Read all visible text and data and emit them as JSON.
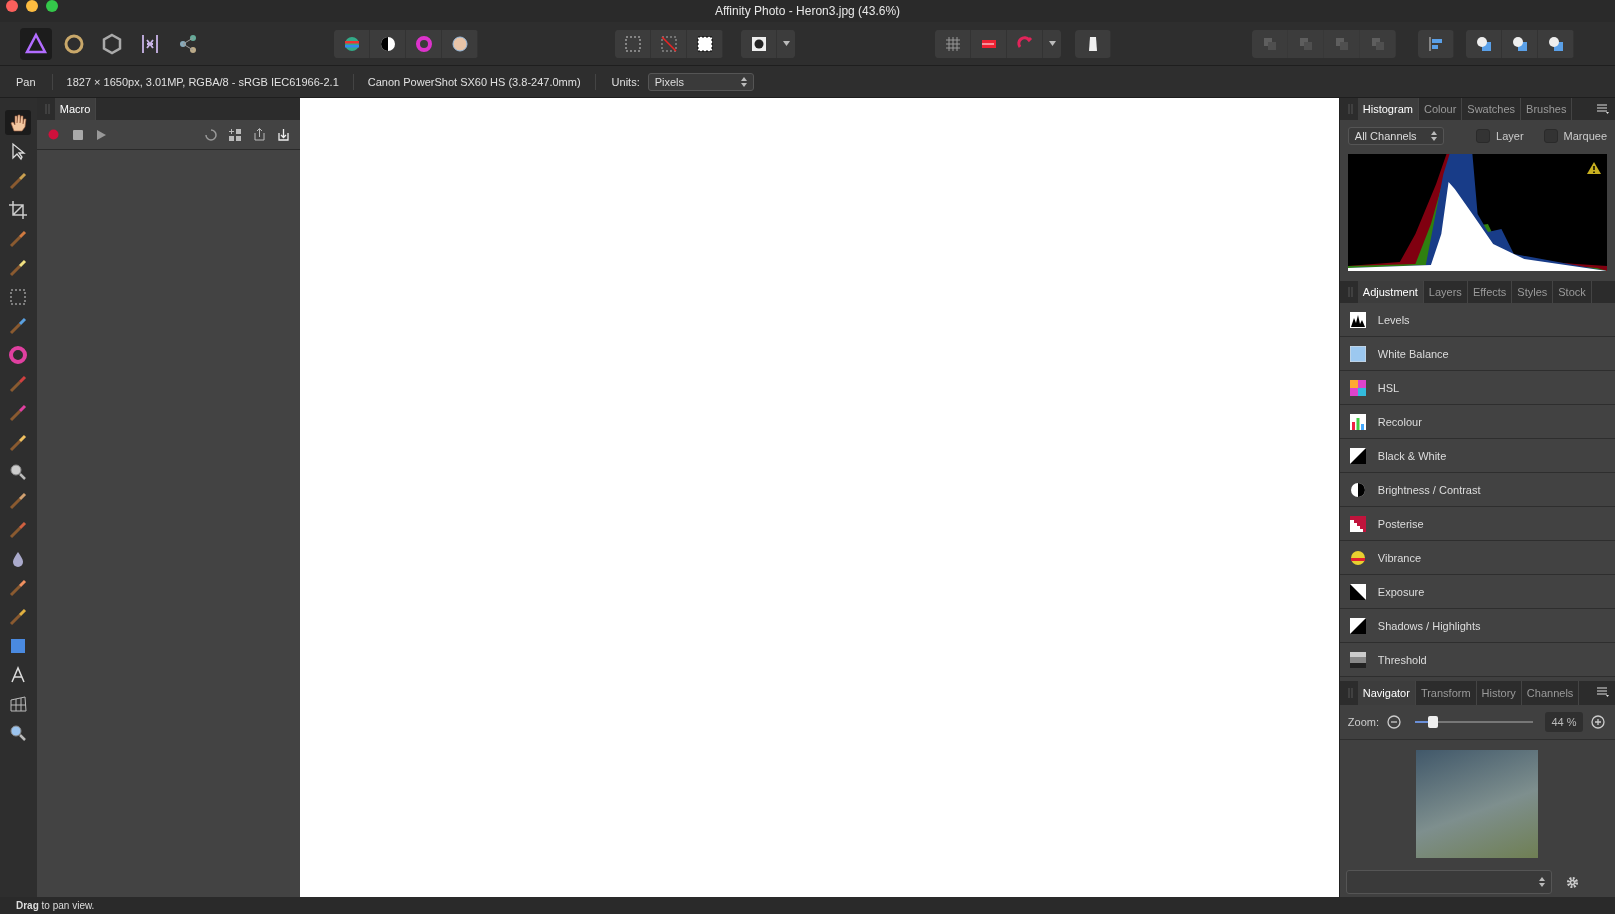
{
  "window": {
    "title": "Affinity Photo - Heron3.jpg (43.6%)"
  },
  "personas": [
    {
      "selected": true
    },
    {
      "selected": false
    },
    {
      "selected": false
    },
    {
      "selected": false
    },
    {
      "selected": false
    }
  ],
  "toolbar_groups": [
    {
      "buttons": [
        {
          "disabled": false
        },
        {
          "disabled": false
        },
        {
          "disabled": false
        },
        {
          "disabled": false
        }
      ]
    },
    {
      "buttons": [
        {
          "disabled": false
        },
        {
          "disabled": false
        },
        {
          "disabled": false
        }
      ]
    },
    {
      "buttons": [
        {
          "disabled": false
        }
      ],
      "dropdown": true
    },
    {
      "buttons": [
        {
          "disabled": false
        },
        {
          "disabled": false
        },
        {
          "disabled": false
        }
      ],
      "dropdown": true
    },
    {
      "buttons": [
        {
          "disabled": false
        }
      ]
    },
    {
      "buttons": [
        {
          "disabled": true
        },
        {
          "disabled": true
        },
        {
          "disabled": true
        },
        {
          "disabled": true
        }
      ]
    },
    {
      "buttons": [
        {
          "disabled": false
        }
      ]
    },
    {
      "buttons": [
        {
          "disabled": false
        },
        {
          "disabled": false
        },
        {
          "disabled": false
        }
      ]
    }
  ],
  "context_bar": {
    "tool": "Pan",
    "image_info": "1827 × 1650px, 3.01MP, RGBA/8 - sRGB IEC61966-2.1",
    "camera": "Canon PowerShot SX60 HS (3.8-247.0mm)",
    "units_label": "Units:",
    "units_value": "Pixels"
  },
  "tools": [
    {
      "selected": true
    },
    {
      "selected": false
    },
    {
      "selected": false
    },
    {
      "selected": false
    },
    {
      "selected": false
    },
    {
      "selected": false
    },
    {
      "selected": false
    },
    {
      "selected": false
    },
    {
      "selected": false
    },
    {
      "selected": false
    },
    {
      "selected": false
    },
    {
      "selected": false
    },
    {
      "selected": false
    },
    {
      "selected": false
    },
    {
      "selected": false
    },
    {
      "selected": false
    },
    {
      "selected": false
    },
    {
      "selected": false
    },
    {
      "selected": false
    },
    {
      "selected": false
    },
    {
      "selected": false
    },
    {
      "selected": false
    }
  ],
  "macro_panel": {
    "tabs": [
      {
        "label": "Macro",
        "selected": true
      }
    ]
  },
  "histogram_panel": {
    "tabs": [
      {
        "label": "Histogram",
        "selected": true
      },
      {
        "label": "Colour",
        "selected": false
      },
      {
        "label": "Swatches",
        "selected": false
      },
      {
        "label": "Brushes",
        "selected": false
      }
    ],
    "channel_select": "All Channels",
    "checkboxes": [
      {
        "label": "Layer",
        "checked": false
      },
      {
        "label": "Marquee",
        "checked": false
      }
    ],
    "warning": true
  },
  "adjustment_panel": {
    "tabs": [
      {
        "label": "Adjustment",
        "selected": true
      },
      {
        "label": "Layers",
        "selected": false
      },
      {
        "label": "Effects",
        "selected": false
      },
      {
        "label": "Styles",
        "selected": false
      },
      {
        "label": "Stock",
        "selected": false
      }
    ],
    "items": [
      {
        "label": "Levels"
      },
      {
        "label": "White Balance"
      },
      {
        "label": "HSL"
      },
      {
        "label": "Recolour"
      },
      {
        "label": "Black & White"
      },
      {
        "label": "Brightness / Contrast"
      },
      {
        "label": "Posterise"
      },
      {
        "label": "Vibrance"
      },
      {
        "label": "Exposure"
      },
      {
        "label": "Shadows / Highlights"
      },
      {
        "label": "Threshold"
      }
    ]
  },
  "navigator_panel": {
    "tabs": [
      {
        "label": "Navigator",
        "selected": true
      },
      {
        "label": "Transform",
        "selected": false
      },
      {
        "label": "History",
        "selected": false
      },
      {
        "label": "Channels",
        "selected": false
      }
    ],
    "zoom_label": "Zoom:",
    "zoom": {
      "level": 0.15
    },
    "zoom_value": "44 %"
  },
  "status_bar": {
    "text": "**Drag** to pan view."
  }
}
